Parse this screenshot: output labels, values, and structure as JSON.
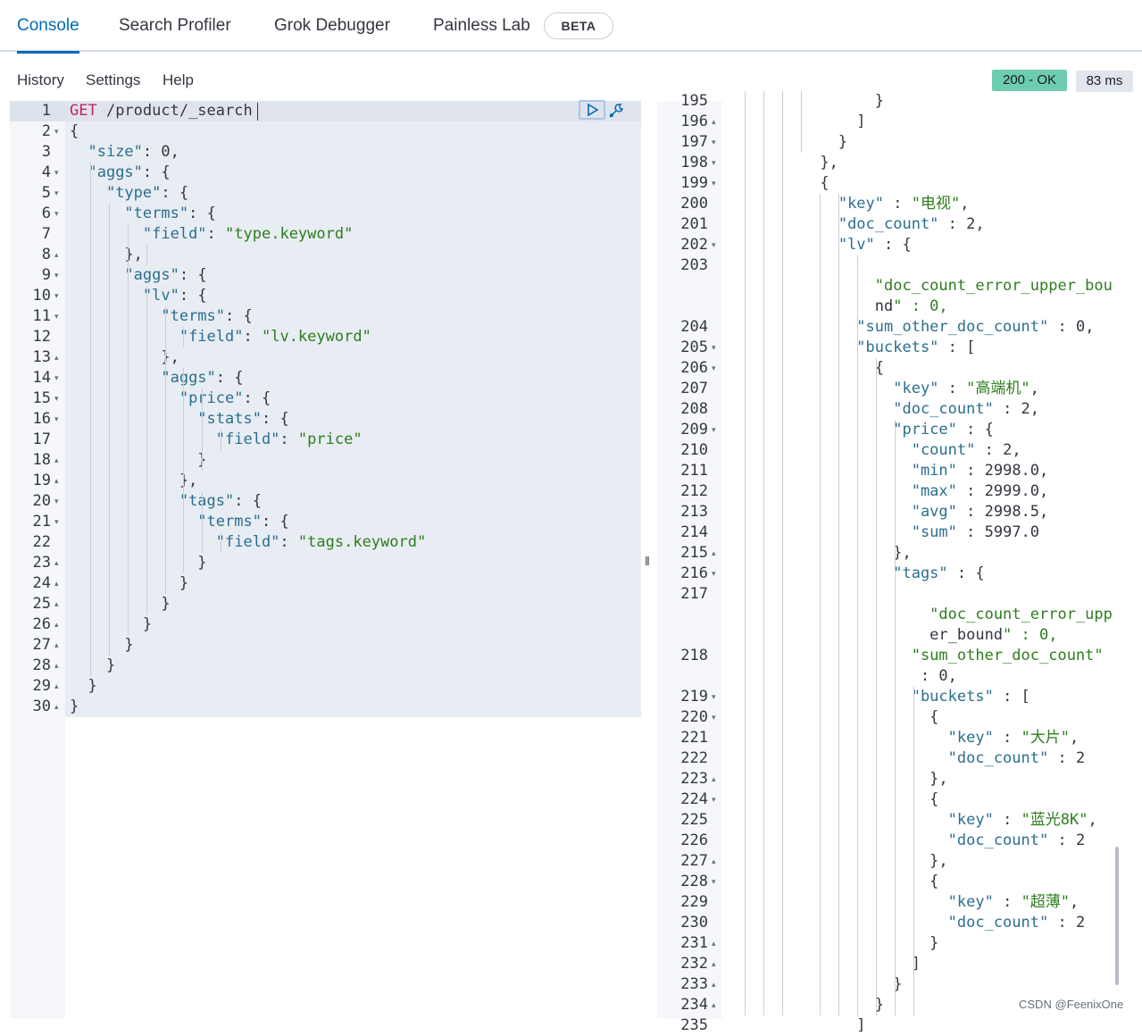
{
  "tabs": [
    {
      "label": "Console",
      "active": true
    },
    {
      "label": "Search Profiler"
    },
    {
      "label": "Grok Debugger"
    },
    {
      "label": "Painless Lab"
    }
  ],
  "beta_badge": "BETA",
  "subnav": {
    "history": "History",
    "settings": "Settings",
    "help": "Help"
  },
  "status": {
    "code": "200 - OK",
    "time": "83 ms"
  },
  "colors": {
    "accent": "#006bb4",
    "status_ok": "#6dccb1",
    "string": "#2e7d1e",
    "key": "#2b6f8f",
    "method": "#c6225f"
  },
  "request": {
    "line1_method": "GET",
    "line1_path": " /product/_search",
    "lines": [
      "{",
      "  \"size\": 0,",
      "  \"aggs\": {",
      "    \"type\": {",
      "      \"terms\": {",
      "        \"field\": \"type.keyword\"",
      "      },",
      "      \"aggs\": {",
      "        \"lv\": {",
      "          \"terms\": {",
      "            \"field\": \"lv.keyword\"",
      "          },",
      "          \"aggs\": {",
      "            \"price\": {",
      "              \"stats\": {",
      "                \"field\": \"price\"",
      "              }",
      "            },",
      "            \"tags\": {",
      "              \"terms\": {",
      "                \"field\": \"tags.keyword\"",
      "              }",
      "            }",
      "          }",
      "        }",
      "      }",
      "    }",
      "  }",
      "}"
    ]
  },
  "response": {
    "line_numbers": [
      "195",
      "196",
      "197",
      "198",
      "199",
      "200",
      "201",
      "202",
      "203",
      "",
      "",
      "204",
      "205",
      "206",
      "207",
      "208",
      "209",
      "210",
      "211",
      "212",
      "213",
      "214",
      "215",
      "216",
      "217",
      "",
      "",
      "218",
      "",
      "219",
      "220",
      "221",
      "222",
      "223",
      "224",
      "225",
      "226",
      "227",
      "228",
      "229",
      "230",
      "231",
      "232",
      "233",
      "234",
      "235"
    ],
    "lines": [
      "                }",
      "              ]",
      "            }",
      "          },",
      "          {",
      "            \"key\" : \"电视\",",
      "            \"doc_count\" : 2,",
      "            \"lv\" : {",
      "",
      "                \"doc_count_error_upper_bou",
      "                nd\" : 0,",
      "              \"sum_other_doc_count\" : 0,",
      "              \"buckets\" : [",
      "                {",
      "                  \"key\" : \"高端机\",",
      "                  \"doc_count\" : 2,",
      "                  \"price\" : {",
      "                    \"count\" : 2,",
      "                    \"min\" : 2998.0,",
      "                    \"max\" : 2999.0,",
      "                    \"avg\" : 2998.5,",
      "                    \"sum\" : 5997.0",
      "                  },",
      "                  \"tags\" : {",
      "",
      "                      \"doc_count_error_upp",
      "                      er_bound\" : 0,",
      "                    \"sum_other_doc_count\"",
      "                     : 0,",
      "                    \"buckets\" : [",
      "                      {",
      "                        \"key\" : \"大片\",",
      "                        \"doc_count\" : 2",
      "                      },",
      "                      {",
      "                        \"key\" : \"蓝光8K\",",
      "                        \"doc_count\" : 2",
      "                      },",
      "                      {",
      "                        \"key\" : \"超薄\",",
      "                        \"doc_count\" : 2",
      "                      }",
      "                    ]",
      "                  }",
      "                }",
      "              ]"
    ]
  },
  "watermark": "CSDN @FeenixOne"
}
